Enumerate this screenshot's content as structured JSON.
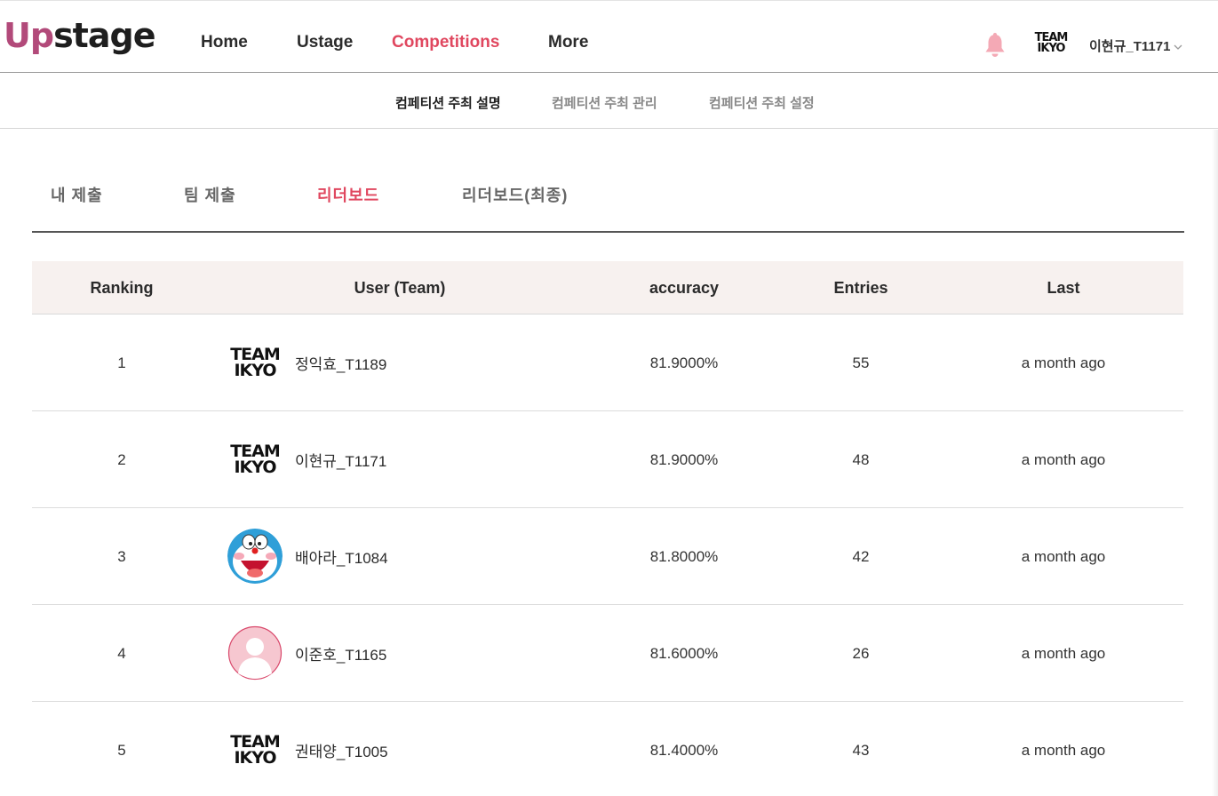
{
  "header": {
    "logo": {
      "part1": "Up",
      "part2": "stage"
    },
    "nav": [
      {
        "label": "Home",
        "active": false
      },
      {
        "label": "Ustage",
        "active": false
      },
      {
        "label": "Competitions",
        "active": true
      },
      {
        "label": "More",
        "active": false
      }
    ],
    "team_logo": {
      "line1": "TEAM",
      "line2": "IKYO"
    },
    "user_name": "이현규_T1171"
  },
  "subnav": [
    {
      "label": "컴페티션 주최 설명",
      "active": true
    },
    {
      "label": "컴페티션 주최 관리",
      "active": false
    },
    {
      "label": "컴페티션 주최 설정",
      "active": false
    }
  ],
  "tabs": [
    {
      "label": "내 제출",
      "active": false
    },
    {
      "label": "팀 제출",
      "active": false
    },
    {
      "label": "리더보드",
      "active": true
    },
    {
      "label": "리더보드(최종)",
      "active": false
    }
  ],
  "table": {
    "headers": [
      "Ranking",
      "User (Team)",
      "accuracy",
      "Entries",
      "Last"
    ],
    "rows": [
      {
        "rank": "1",
        "user": "정익효_T1189",
        "avatar": "team-ikyo-logo",
        "accuracy": "81.9000%",
        "entries": "55",
        "last": "a month ago"
      },
      {
        "rank": "2",
        "user": "이현규_T1171",
        "avatar": "team-ikyo-logo",
        "accuracy": "81.9000%",
        "entries": "48",
        "last": "a month ago"
      },
      {
        "rank": "3",
        "user": "배아라_T1084",
        "avatar": "doraemon-avatar",
        "accuracy": "81.8000%",
        "entries": "42",
        "last": "a month ago"
      },
      {
        "rank": "4",
        "user": "이준호_T1165",
        "avatar": "default-person-avatar",
        "accuracy": "81.6000%",
        "entries": "26",
        "last": "a month ago"
      },
      {
        "rank": "5",
        "user": "권태양_T1005",
        "avatar": "team-ikyo-logo",
        "accuracy": "81.4000%",
        "entries": "43",
        "last": "a month ago"
      }
    ]
  },
  "colors": {
    "accent": "#e0475f",
    "logo_accent": "#b24a7a",
    "header_row_bg": "#f7f1ef",
    "bell": "#f4a9b5"
  }
}
